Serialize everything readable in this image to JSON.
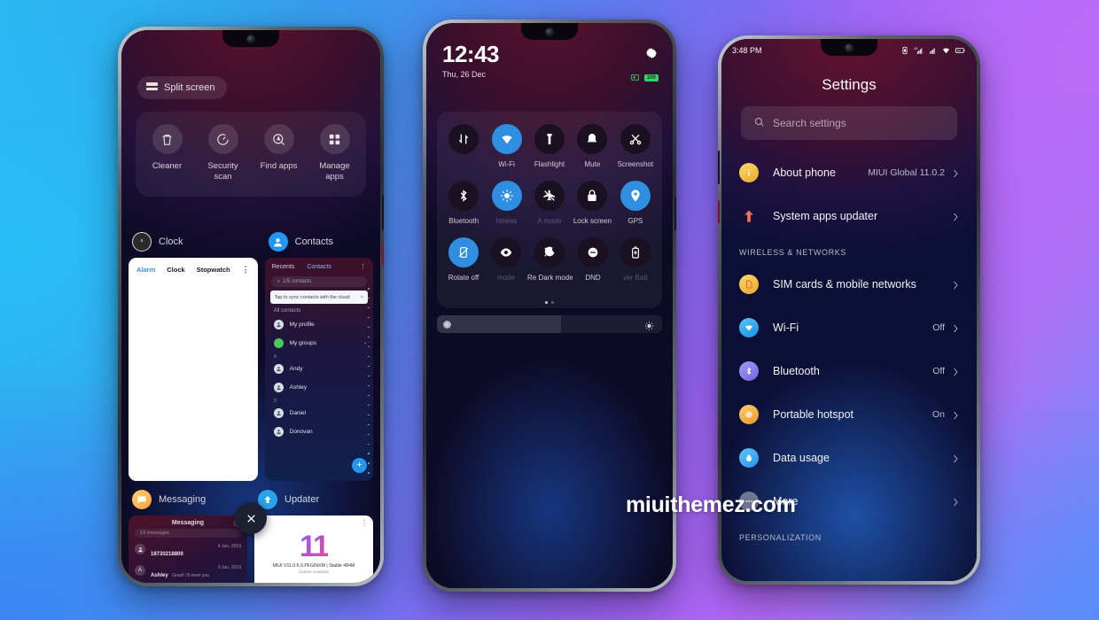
{
  "watermark": "miuithemez.com",
  "phone1": {
    "split_screen": {
      "label": "Split screen",
      "icon": "split-screen-icon"
    },
    "quick_actions": [
      {
        "label": "Cleaner",
        "icon": "trash-icon"
      },
      {
        "label": "Security\nscan",
        "label_line1": "Security",
        "label_line2": "scan",
        "icon": "security-scan-icon"
      },
      {
        "label": "Find apps",
        "icon": "find-apps-icon"
      },
      {
        "label": "Manage\napps",
        "label_line1": "Manage",
        "label_line2": "apps",
        "icon": "manage-apps-icon"
      }
    ],
    "cards": {
      "clock": {
        "title": "Clock",
        "icon": "clock-icon",
        "tabs": [
          "Alarm",
          "Clock",
          "Stopwatch"
        ],
        "menu": "overflow-menu-icon"
      },
      "contacts": {
        "title": "Contacts",
        "icon": "contacts-icon",
        "tabs": [
          "Recents",
          "Contacts"
        ],
        "selected_tab": "Contacts",
        "search_placeholder": "1/5 contacts",
        "banner": "Tap to sync contacts with the cloud",
        "group_label": "All contacts",
        "rows": [
          {
            "name": "My profile",
            "type": "profile"
          },
          {
            "name": "My groups",
            "type": "group"
          },
          {
            "name": "Andy",
            "type": "contact"
          },
          {
            "name": "Ashley",
            "type": "contact"
          },
          {
            "name": "Daniel",
            "type": "contact"
          },
          {
            "name": "Donovan",
            "type": "contact"
          }
        ],
        "section_a": "A",
        "section_d": "D",
        "fab": "add-contact-fab"
      },
      "messaging": {
        "title": "Messaging",
        "icon": "messaging-icon",
        "header": "Messaging",
        "search_placeholder": "13 messages",
        "rows": [
          {
            "name": "18730218809",
            "preview": "",
            "date": "4 Jun, 2019"
          },
          {
            "name": "Ashley",
            "preview": "Great! I'll meet you downstairs in ten minutes. Don't forget.",
            "date": "9 Jun, 2019"
          }
        ]
      },
      "updater": {
        "title": "Updater",
        "icon": "updater-icon",
        "logo": "11",
        "version": "MIUI V11.0.6.0.PFGINXM | Stable 484M",
        "status": "Update available"
      }
    },
    "close_button": "close-recents-button"
  },
  "phone2": {
    "time": "12:43",
    "date": "Thu, 26 Dec",
    "gear": "settings-gear-icon",
    "battery": "100",
    "tiles_row1": [
      {
        "label": "",
        "icon": "mobile-data-icon",
        "active": false
      },
      {
        "label": "Wi-Fi",
        "icon": "wifi-icon",
        "active": true
      },
      {
        "label": "Flashlight",
        "icon": "flashlight-icon",
        "active": false
      },
      {
        "label": "Mute",
        "icon": "mute-bell-icon",
        "active": false
      },
      {
        "label": "Screenshot",
        "icon": "screenshot-scissors-icon",
        "active": false
      }
    ],
    "tiles_row2": [
      {
        "label": "Bluetooth",
        "icon": "bluetooth-icon",
        "active": false
      },
      {
        "label": "Brightness",
        "label_visible": "htness",
        "icon": "brightness-icon",
        "active": true
      },
      {
        "label": "Airplane mode",
        "label_visible": "A     mode",
        "icon": "airplane-mode-icon",
        "active": false
      },
      {
        "label": "Lock screen",
        "icon": "lock-screen-icon",
        "active": false
      },
      {
        "label": "GPS",
        "icon": "gps-icon",
        "active": true
      }
    ],
    "tiles_row3": [
      {
        "label": "Rotate off",
        "icon": "rotate-off-icon",
        "active": true
      },
      {
        "label": "Reading mode",
        "label_visible": "mode",
        "icon": "reading-mode-eye-icon",
        "active": false
      },
      {
        "label": "Dark mode",
        "label_visible": "Re   Dark mode",
        "icon": "dark-mode-icon",
        "active": false
      },
      {
        "label": "DND",
        "icon": "dnd-icon",
        "active": false
      },
      {
        "label": "Battery saver",
        "label_visible": "ver    Batt",
        "icon": "battery-saver-icon",
        "active": false
      }
    ],
    "brightness": {
      "value": 55,
      "icon": "sun-icon"
    }
  },
  "phone3": {
    "status_time": "3:48 PM",
    "battery": "54",
    "title": "Settings",
    "search_placeholder": "Search settings",
    "items": [
      {
        "label": "About phone",
        "value": "MIUI Global 11.0.2",
        "icon": "info-icon",
        "color": "#f3c14a"
      },
      {
        "label": "System apps updater",
        "value": "",
        "icon": "arrow-up-icon",
        "color": "#f2705a"
      }
    ],
    "section_wireless": "WIRELESS & NETWORKS",
    "wireless_items": [
      {
        "label": "SIM cards & mobile networks",
        "value": "",
        "icon": "sim-card-icon",
        "color": "#f4c152"
      },
      {
        "label": "Wi-Fi",
        "value": "Off",
        "icon": "wifi-icon",
        "color": "#2aa3f0"
      },
      {
        "label": "Bluetooth",
        "value": "Off",
        "icon": "bluetooth-icon",
        "color": "#8b7ff0"
      },
      {
        "label": "Portable hotspot",
        "value": "On",
        "icon": "hotspot-icon",
        "color": "#f0b84a"
      },
      {
        "label": "Data usage",
        "value": "",
        "icon": "data-usage-icon",
        "color": "#3aa9f2"
      },
      {
        "label": "More",
        "value": "",
        "icon": "more-dots-icon",
        "color": "#7c85a8"
      }
    ],
    "section_personalization": "PERSONALIZATION"
  }
}
